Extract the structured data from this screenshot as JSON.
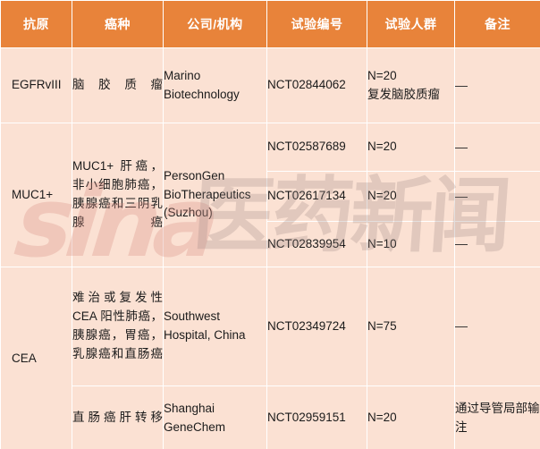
{
  "table": {
    "headers": [
      "抗原",
      "癌种",
      "公司/机构",
      "试验编号",
      "试验人群",
      "备注"
    ],
    "colors": {
      "header_bg": "#E8833A",
      "header_text": "#FFFFFF",
      "cell_bg": "#FBE1D3",
      "cell_text": "#1B1B1B",
      "gridline": "#FFFFFF"
    },
    "rows": [
      {
        "antigen": "EGFRvIII",
        "cancer": "脑胶质瘤",
        "company": "Marino Biotechnology",
        "trials": [
          {
            "id": "NCT02844062",
            "population": "N=20\n复发脑胶质瘤",
            "population_line1": "N=20",
            "population_line2": "复发脑胶质瘤",
            "note": "—"
          }
        ]
      },
      {
        "antigen": "MUC1+",
        "cancer": "MUC1+ 肝癌，非小细胞肺癌，胰腺癌和三阴乳腺癌",
        "company": "PersonGen BioTherapeutics (Suzhou)",
        "trials": [
          {
            "id": "NCT02587689",
            "population": "N=20",
            "note": "—"
          },
          {
            "id": "NCT02617134",
            "population": "N=20",
            "note": "—"
          },
          {
            "id": "NCT02839954",
            "population": "N=10",
            "note": "—"
          }
        ]
      },
      {
        "antigen": "CEA",
        "subrows": [
          {
            "cancer": "难治或复发性CEA 阳性肺癌，胰腺癌，胃癌，乳腺癌和直肠癌",
            "company": "Southwest Hospital, China",
            "id": "NCT02349724",
            "population": "N=75",
            "note": "—"
          },
          {
            "cancer": "直肠癌肝转移",
            "company": "Shanghai GeneChem",
            "id": "NCT02959151",
            "population": "N=20",
            "note": "通过导管局部输注"
          }
        ]
      }
    ]
  },
  "watermark": {
    "brand": "sina",
    "text_cn": "医药新闻"
  }
}
